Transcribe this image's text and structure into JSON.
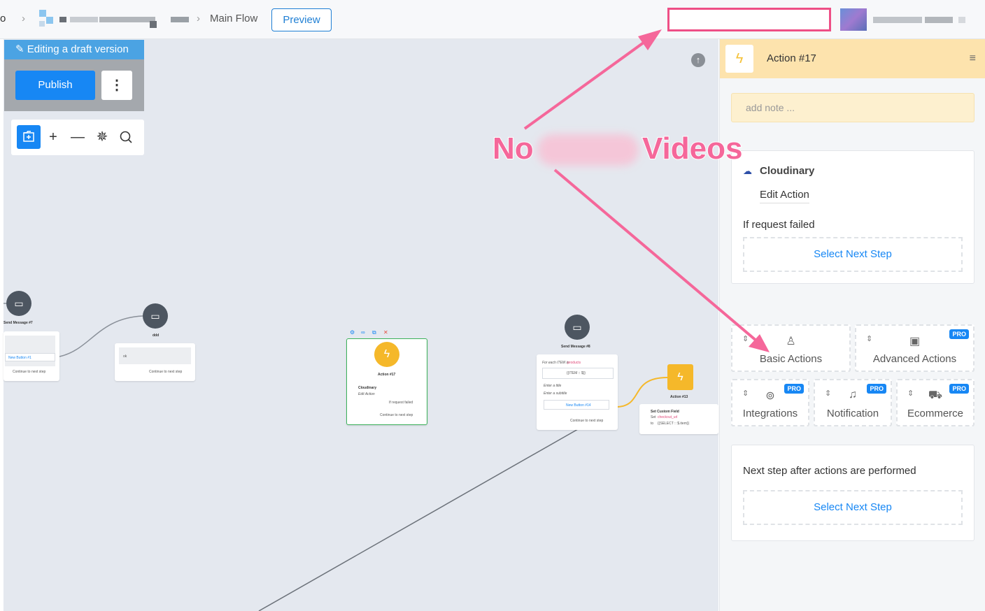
{
  "header": {
    "crumb_prefix": "o",
    "current_flow": "Main Flow",
    "preview_label": "Preview"
  },
  "canvas": {
    "draft_label": "Editing a draft version",
    "publish_label": "Publish",
    "nodes": {
      "send7_title": "Send Message #7",
      "send7_button": "New Button #1",
      "send7_continue": "Continue to next step",
      "ddd_title": "ddd",
      "ddd_text": "ok",
      "ddd_continue": "Continue to next step",
      "action17_title": "Action #17",
      "action17_app": "Cloudinary",
      "action17_edit": "Edit Action",
      "action17_failed": "If request failed",
      "action17_continue": "Continue to next step",
      "send8_title": "Send Message #8",
      "send8_foreach": "For each ITEM in",
      "send8_products": "products",
      "send8_item": "{{ITEM :: $}}",
      "send8_title_ph": "Enter a title",
      "send8_subtitle_ph": "Enter a subtitle",
      "send8_button": "New Button #14",
      "send8_continue": "Continue to next step",
      "action13_title": "Action #13",
      "action13_set": "Set Custom Field",
      "action13_set_word": "Set",
      "action13_field": "checkout_url",
      "action13_to": "to",
      "action13_value": "{{SELECT :: $.item}}"
    }
  },
  "sidebar": {
    "title": "Action #17",
    "note_placeholder": "add note ...",
    "app_name": "Cloudinary",
    "edit_action": "Edit Action",
    "if_failed": "If request failed",
    "select_next_step": "Select Next Step",
    "tiles": {
      "basic": "Basic Actions",
      "advanced": "Advanced Actions",
      "integrations": "Integrations",
      "notification": "Notification",
      "ecommerce": "Ecommerce",
      "pro": "PRO"
    },
    "next_step_caption": "Next step after actions are performed",
    "select_next_step_2": "Select Next Step"
  },
  "annotation": {
    "word_left": "No",
    "word_right": "Videos"
  },
  "colors": {
    "accent": "#1787f4",
    "annotation": "#f5679a",
    "header_bg": "#fde3ad",
    "canvas_bg": "#e4e8ef"
  },
  "icons": [
    "edit-icon",
    "kebab-icon",
    "folder-add-icon",
    "plus-icon",
    "minus-icon",
    "magic-icon",
    "search-icon",
    "upload-icon",
    "message-icon",
    "bolt-icon",
    "cloud-icon",
    "user-icon",
    "briefcase-icon",
    "link-icon",
    "bell-icon",
    "cart-icon",
    "menu-icon"
  ]
}
